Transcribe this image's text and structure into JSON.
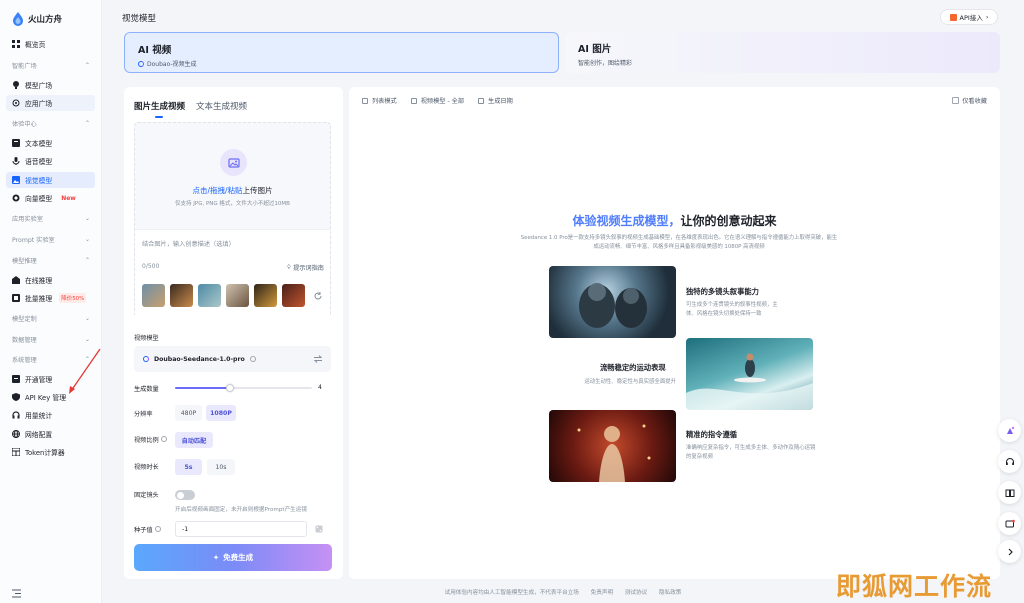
{
  "brand": {
    "name": "火山方舟"
  },
  "sidebar": {
    "overview": "概览页",
    "groups": {
      "smart_square": "智能广场",
      "experience": "体验中心",
      "app_lab": "应用实验室",
      "prompt_lab": "Prompt 实验室",
      "model_infer": "模型推理",
      "model_custom": "模型定制",
      "data_mgmt": "数据管理",
      "system_mgmt": "系统管理"
    },
    "items": {
      "model_square": "模型广场",
      "app_square": "应用广场",
      "text_model": "文本模型",
      "voice_model": "语音模型",
      "visual_model": "视觉模型",
      "vector_model": "向量模型",
      "new_tag": "New",
      "online_infer": "在线推理",
      "batch_infer": "批量推理",
      "batch_discount": "降价50%",
      "activation": "开通管理",
      "api_key": "API Key 管理",
      "usage": "用量统计",
      "network": "网络配置",
      "token_calc": "Token计算器"
    }
  },
  "header": {
    "title": "视觉模型",
    "api_button": "API接入"
  },
  "modes": {
    "video": {
      "title": "AI 视频",
      "subtitle": "Doubao-视频生成"
    },
    "image": {
      "title": "AI 图片",
      "subtitle": "智能创作，图绘精彩"
    }
  },
  "left": {
    "tabs": [
      "图片生成视频",
      "文本生成视频"
    ],
    "upload": {
      "title_hl": "点击/拖拽/粘贴",
      "title_rest": "上传图片",
      "sub": "仅支持 JPG, PNG 格式，文件大小不超过10MB"
    },
    "prompt_placeholder": "结合图片，输入创意描述（选填）",
    "count": "0/500",
    "hint": "提示词指南",
    "labels": {
      "model": "视频模型",
      "count": "生成数量",
      "resolution": "分辨率",
      "ratio": "视频比例",
      "duration": "视频时长",
      "fixed": "固定镜头",
      "seed": "种子值"
    },
    "model_name": "Doubao-Seedance-1.0-pro",
    "gen_count": "4",
    "gen_count_fraction": 0.4,
    "resolutions": [
      "480P",
      "1080P"
    ],
    "ratio": "自动匹配",
    "durations": [
      "5s",
      "10s"
    ],
    "fixed_desc": "开启后视频画面固定，未开启则根据Prompt产生运镜",
    "seed": "-1",
    "generate": "免费生成"
  },
  "right": {
    "filters": [
      "列表模式",
      "视频模型 - 全部",
      "生成日期"
    ],
    "fav": "仅看收藏",
    "hero_hl": "体验视频生成模型，",
    "hero_rest": "让你的创意动起来",
    "hero_desc": "Seedance 1.0 Pro是一款支持多镜头叙事的视频生成基础模型，在各维度表现出色。它在语义理解与指令遵循能力上取得突破，能生成运动流畅、细节丰富、风格多样且具备影视级美感的 1080P 高清视频",
    "features": [
      {
        "title": "独特的多镜头叙事能力",
        "desc": "可生成多个连贯镜头的叙事性视频，主体、风格在镜头切换处保持一致"
      },
      {
        "title": "流畅稳定的运动表现",
        "desc": "运动生动性、稳定性与真实感全面提升"
      },
      {
        "title": "精准的指令遵循",
        "desc": "准确响应复杂指令，可生成多主体、多动作及随心运镜的复杂视频"
      }
    ]
  },
  "footer": [
    "试用体验内容均由人工智能模型生成，不代表平台立场",
    "免责声明",
    "测试协议",
    "隐私政策"
  ],
  "watermark": "即狐网工作流",
  "colors": {
    "accent": "#1664ff",
    "purple": "#6b6ef5"
  }
}
